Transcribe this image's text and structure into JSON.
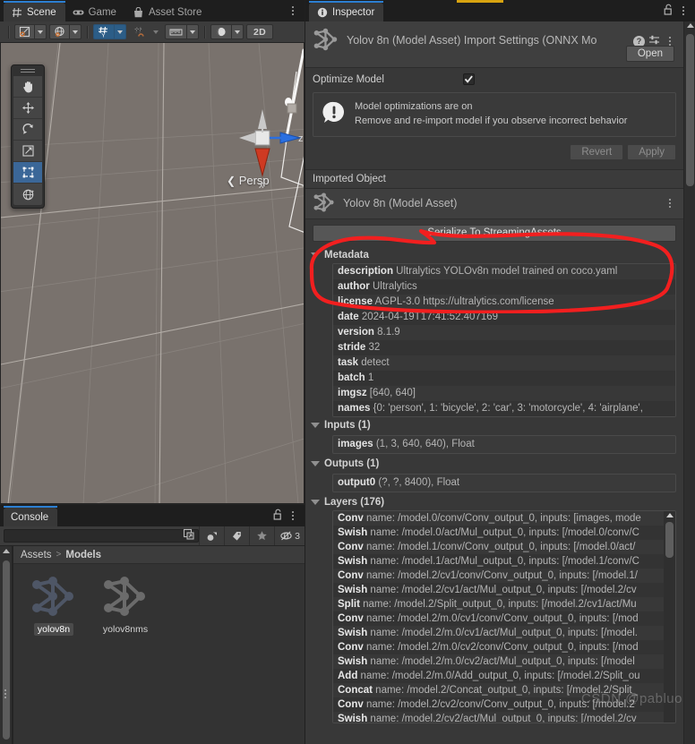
{
  "app": {
    "accent_yellow": "#d8a310",
    "accent_blue": "#2c7fd2",
    "annotation_color": "#f21f1f"
  },
  "scene_panel": {
    "tabs": [
      {
        "label": "Scene",
        "icon": "grid-icon",
        "active": true
      },
      {
        "label": "Game",
        "icon": "gamepad-icon",
        "active": false
      },
      {
        "label": "Asset Store",
        "icon": "shop-bag-icon",
        "active": false
      }
    ],
    "toolbar": {
      "draw_mode": "shaded-wireframe-icon",
      "lighting": "globe-icon",
      "grid_snap": "grid-y-icon",
      "magnet_snap": "magnet-snap-icon",
      "ruler": "ruler-icon",
      "audio": "sphere-icon",
      "view_mode_label": "2D"
    },
    "tools": [
      {
        "name": "hand-tool",
        "selected": false
      },
      {
        "name": "move-tool",
        "selected": false
      },
      {
        "name": "rotate-tool",
        "selected": false
      },
      {
        "name": "scale-tool",
        "selected": false
      },
      {
        "name": "rect-tool",
        "selected": true
      },
      {
        "name": "transform-tool",
        "selected": false
      }
    ],
    "viewport": {
      "perspective_label": "Persp",
      "gizmo_axis_x": "x",
      "gizmo_axis_z": "z",
      "background_color": "#79726d"
    }
  },
  "console_panel": {
    "tabs": [
      {
        "label": "Console",
        "active": true
      }
    ],
    "search": {
      "value": "",
      "placeholder": ""
    },
    "toolbar_icons": [
      "clear-on-play-icon",
      "error-pause-icon",
      "tag-filter-icon",
      "favorite-star-icon",
      "collapse-icon"
    ],
    "message_count": "3",
    "breadcrumb": {
      "root": "Assets",
      "separator": ">",
      "current": "Models"
    },
    "assets": [
      {
        "label": "yolov8n",
        "icon": "model-asset-icon",
        "selected": true
      },
      {
        "label": "yolov8nms",
        "icon": "model-asset-icon",
        "selected": false
      }
    ]
  },
  "inspector": {
    "tabs": [
      {
        "label": "Inspector",
        "icon": "info-icon",
        "active": true
      }
    ],
    "lock_icon": "lock-open-icon",
    "menu_icon": "kebab-menu-icon",
    "importer": {
      "title": "Yolov 8n (Model Asset) Import Settings (ONNX Mo",
      "icon": "model-asset-icon",
      "help_icon": "help-icon",
      "preset_icon": "preset-sliders-icon",
      "kebab_icon": "kebab-menu-icon",
      "open_button": "Open"
    },
    "optimize": {
      "label": "Optimize Model",
      "checked": true,
      "info_line1": "Model optimizations are on",
      "info_line2": "Remove and re-import model if you observe incorrect behavior",
      "revert_button": "Revert",
      "apply_button": "Apply"
    },
    "imported_object": {
      "section_label": "Imported Object",
      "asset_title": "Yolov 8n (Model Asset)",
      "serialize_button": "Serialize To StreamingAssets"
    },
    "metadata": {
      "foldout_label": "Metadata",
      "rows": [
        {
          "key": "description",
          "value": "Ultralytics YOLOv8n model trained on coco.yaml"
        },
        {
          "key": "author",
          "value": "Ultralytics"
        },
        {
          "key": "license",
          "value": "AGPL-3.0 https://ultralytics.com/license"
        },
        {
          "key": "date",
          "value": "2024-04-19T17:41:52.407169"
        },
        {
          "key": "version",
          "value": "8.1.9"
        },
        {
          "key": "stride",
          "value": "32"
        },
        {
          "key": "task",
          "value": "detect"
        },
        {
          "key": "batch",
          "value": "1"
        },
        {
          "key": "imgsz",
          "value": "[640, 640]"
        },
        {
          "key": "names",
          "value": "{0: 'person', 1: 'bicycle', 2: 'car', 3: 'motorcycle', 4: 'airplane', "
        }
      ]
    },
    "inputs": {
      "foldout_label": "Inputs (1)",
      "rows": [
        {
          "key": "images",
          "value": "(1, 3, 640, 640), Float"
        }
      ]
    },
    "outputs": {
      "foldout_label": "Outputs (1)",
      "rows": [
        {
          "key": "output0",
          "value": "(?, ?, 8400), Float"
        }
      ]
    },
    "layers": {
      "foldout_label": "Layers (176)",
      "rows": [
        {
          "key": "Conv",
          "value": "name: /model.0/conv/Conv_output_0, inputs: [images, mode"
        },
        {
          "key": "Swish",
          "value": "name: /model.0/act/Mul_output_0, inputs: [/model.0/conv/C"
        },
        {
          "key": "Conv",
          "value": "name: /model.1/conv/Conv_output_0, inputs: [/model.0/act/"
        },
        {
          "key": "Swish",
          "value": "name: /model.1/act/Mul_output_0, inputs: [/model.1/conv/C"
        },
        {
          "key": "Conv",
          "value": "name: /model.2/cv1/conv/Conv_output_0, inputs: [/model.1/"
        },
        {
          "key": "Swish",
          "value": "name: /model.2/cv1/act/Mul_output_0, inputs: [/model.2/cv"
        },
        {
          "key": "Split",
          "value": "name: /model.2/Split_output_0, inputs: [/model.2/cv1/act/Mu"
        },
        {
          "key": "Conv",
          "value": "name: /model.2/m.0/cv1/conv/Conv_output_0, inputs: [/mod"
        },
        {
          "key": "Swish",
          "value": "name: /model.2/m.0/cv1/act/Mul_output_0, inputs: [/model."
        },
        {
          "key": "Conv",
          "value": "name: /model.2/m.0/cv2/conv/Conv_output_0, inputs: [/mod"
        },
        {
          "key": "Swish",
          "value": "name: /model.2/m.0/cv2/act/Mul_output_0, inputs: [/model"
        },
        {
          "key": "Add",
          "value": "name: /model.2/m.0/Add_output_0, inputs: [/model.2/Split_ou"
        },
        {
          "key": "Concat",
          "value": "name: /model.2/Concat_output_0, inputs: [/model.2/Split_"
        },
        {
          "key": "Conv",
          "value": "name: /model.2/cv2/conv/Conv_output_0, inputs: [/model.2"
        },
        {
          "key": "Swish",
          "value": "name: /model.2/cv2/act/Mul_output_0, inputs: [/model.2/cv"
        }
      ]
    }
  },
  "watermark": "CSDN @pabluo"
}
